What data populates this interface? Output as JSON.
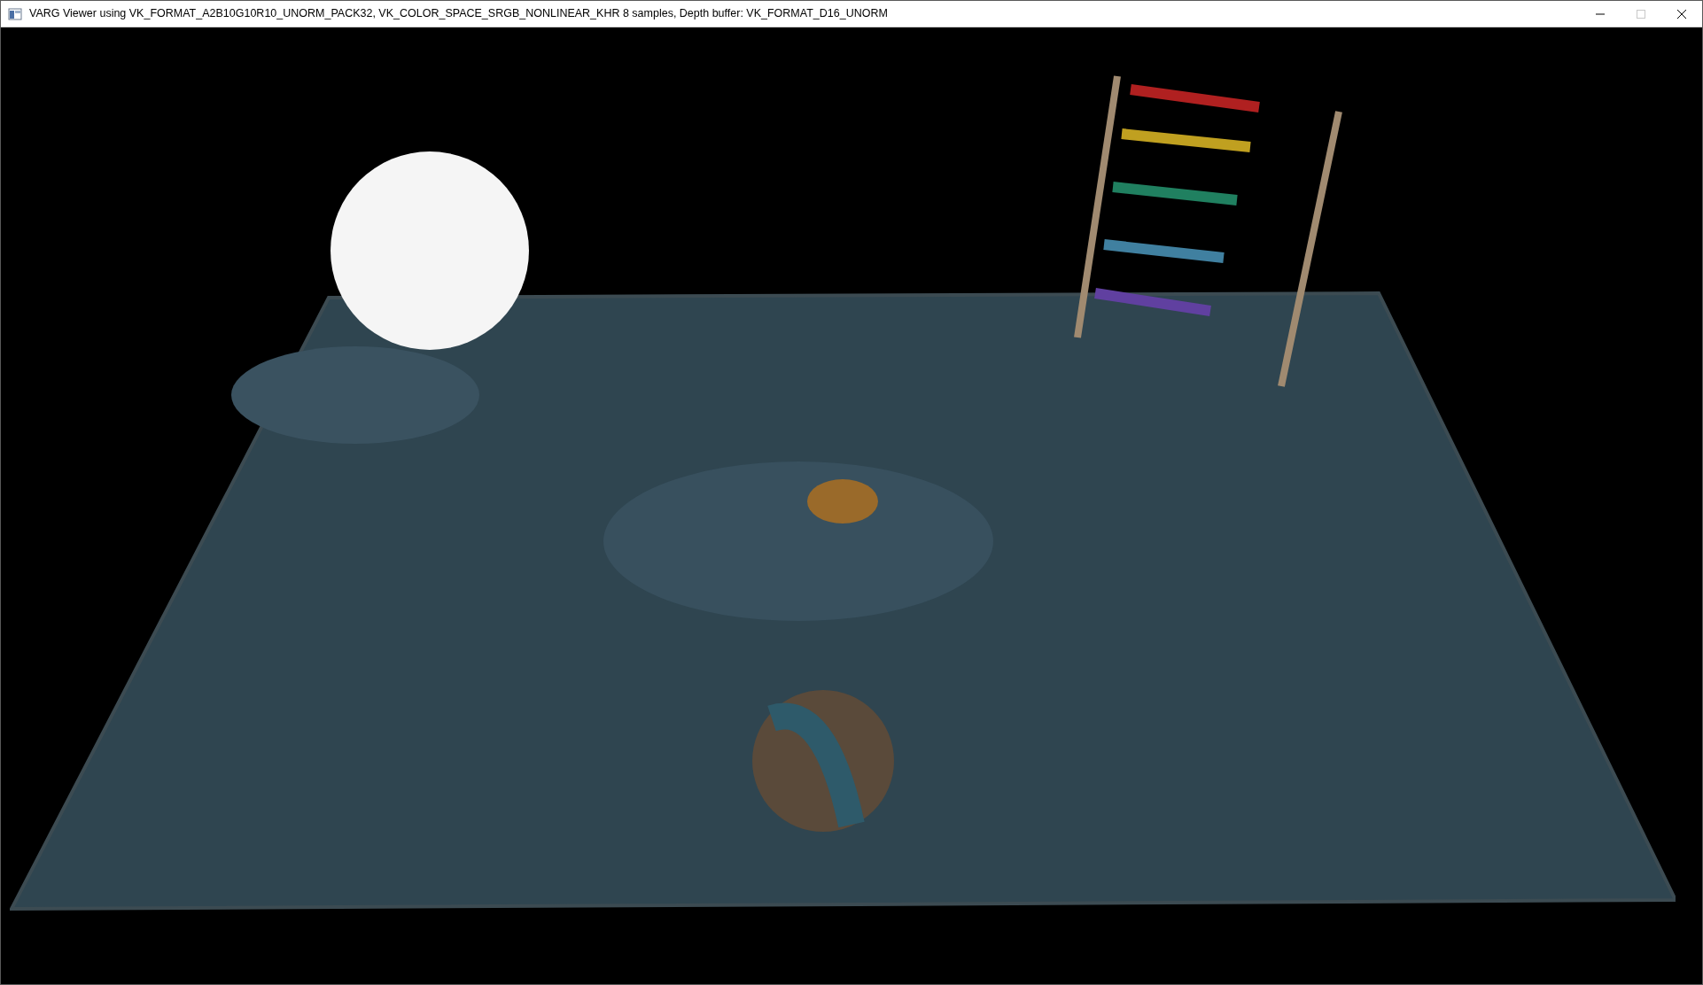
{
  "window": {
    "title": "VARG Viewer using VK_FORMAT_A2B10G10R10_UNORM_PACK32, VK_COLOR_SPACE_SRGB_NONLINEAR_KHR 8 samples, Depth buffer: VK_FORMAT_D16_UNORM",
    "controls": [
      {
        "kind": "minimize",
        "disabled": false
      },
      {
        "kind": "maximize",
        "disabled": true
      },
      {
        "kind": "close",
        "disabled": false
      }
    ]
  }
}
